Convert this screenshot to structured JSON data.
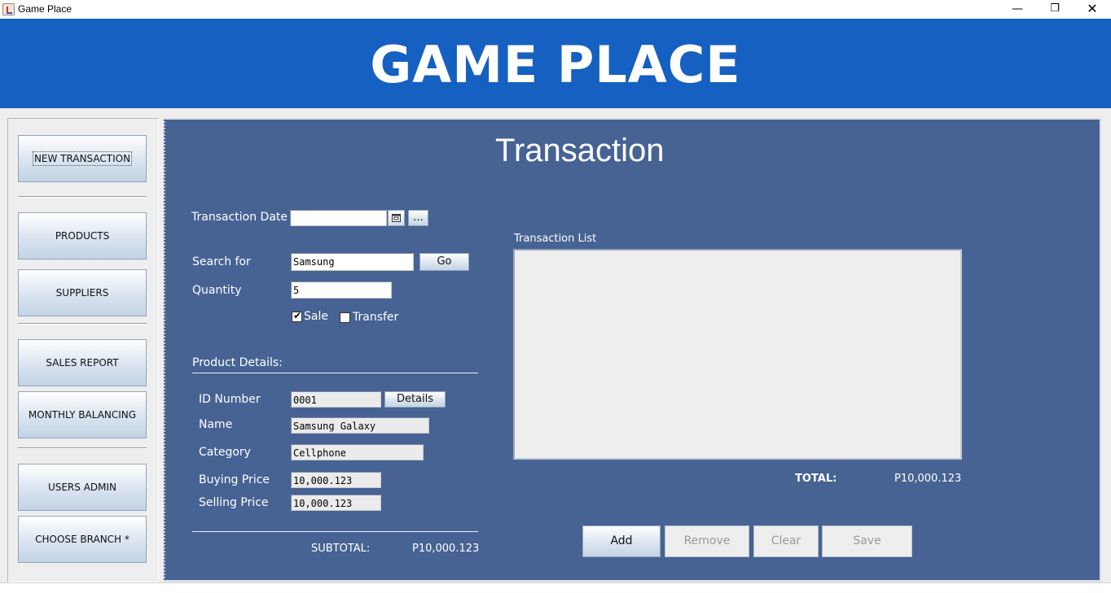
{
  "window": {
    "title": "Game Place",
    "minimize_glyph": "—",
    "maximize_glyph": "❐",
    "close_glyph": "✕"
  },
  "banner": {
    "title": "GAME PLACE"
  },
  "colors": {
    "banner": "#1560c1",
    "panel": "#476394"
  },
  "sidebar": {
    "items": [
      {
        "label": "NEW TRANSACTION"
      },
      {
        "label": "PRODUCTS"
      },
      {
        "label": "SUPPLIERS"
      },
      {
        "label": "SALES REPORT"
      },
      {
        "label": "MONTHLY BALANCING"
      },
      {
        "label": "USERS ADMIN"
      },
      {
        "label": "CHOOSE BRANCH *"
      }
    ]
  },
  "main": {
    "heading": "Transaction",
    "transaction_date_label": "Transaction Date",
    "transaction_date_value": "",
    "date_picker_label": "...",
    "search_label": "Search for",
    "search_value": "Samsung",
    "go_label": "Go",
    "quantity_label": "Quantity",
    "quantity_value": "5",
    "sale_label": "Sale",
    "sale_checked": true,
    "transfer_label": "Transfer",
    "transfer_checked": false,
    "product_details": {
      "heading": "Product Details:",
      "id_label": "ID Number",
      "id_value": "0001",
      "details_button": "Details",
      "name_label": "Name",
      "name_value": "Samsung Galaxy",
      "category_label": "Category",
      "category_value": "Cellphone",
      "buying_label": "Buying Price",
      "buying_value": "10,000.123",
      "selling_label": "Selling Price",
      "selling_value": "10,000.123",
      "subtotal_label": "SUBTOTAL:",
      "subtotal_value": "P10,000.123"
    },
    "transaction_list": {
      "label": "Transaction List",
      "items": [],
      "total_label": "TOTAL:",
      "total_value": "P10,000.123"
    },
    "actions": {
      "add": "Add",
      "remove": "Remove",
      "clear": "Clear",
      "save": "Save"
    }
  }
}
